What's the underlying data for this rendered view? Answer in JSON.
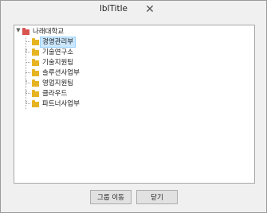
{
  "window": {
    "title": "lblTitle",
    "close_glyph": "✕"
  },
  "tree": {
    "root": {
      "label": "나래대학교",
      "expander": "▼",
      "icon": "folder-red-icon"
    },
    "children": [
      {
        "label": "경영관리부",
        "selected": true,
        "expandable": false,
        "icon": "folder-yellow-icon"
      },
      {
        "label": "기술연구소",
        "selected": false,
        "expandable": true,
        "icon": "folder-yellow-icon"
      },
      {
        "label": "기술지원팀",
        "selected": false,
        "expandable": false,
        "icon": "folder-yellow-icon"
      },
      {
        "label": "솔루션사업부",
        "selected": false,
        "expandable": false,
        "icon": "folder-yellow-icon"
      },
      {
        "label": "영업지원팀",
        "selected": false,
        "expandable": true,
        "icon": "folder-yellow-icon"
      },
      {
        "label": "클라우드",
        "selected": false,
        "expandable": true,
        "icon": "folder-yellow-icon"
      },
      {
        "label": "파트너사업부",
        "selected": false,
        "expandable": true,
        "icon": "folder-yellow-icon"
      }
    ],
    "collapsed_glyph": "›"
  },
  "buttons": {
    "move_group": "그룹 이동",
    "close": "닫기"
  },
  "colors": {
    "selection_bg": "#cce8ff",
    "folder_yellow": "#e6b422",
    "folder_red": "#d9534f"
  }
}
